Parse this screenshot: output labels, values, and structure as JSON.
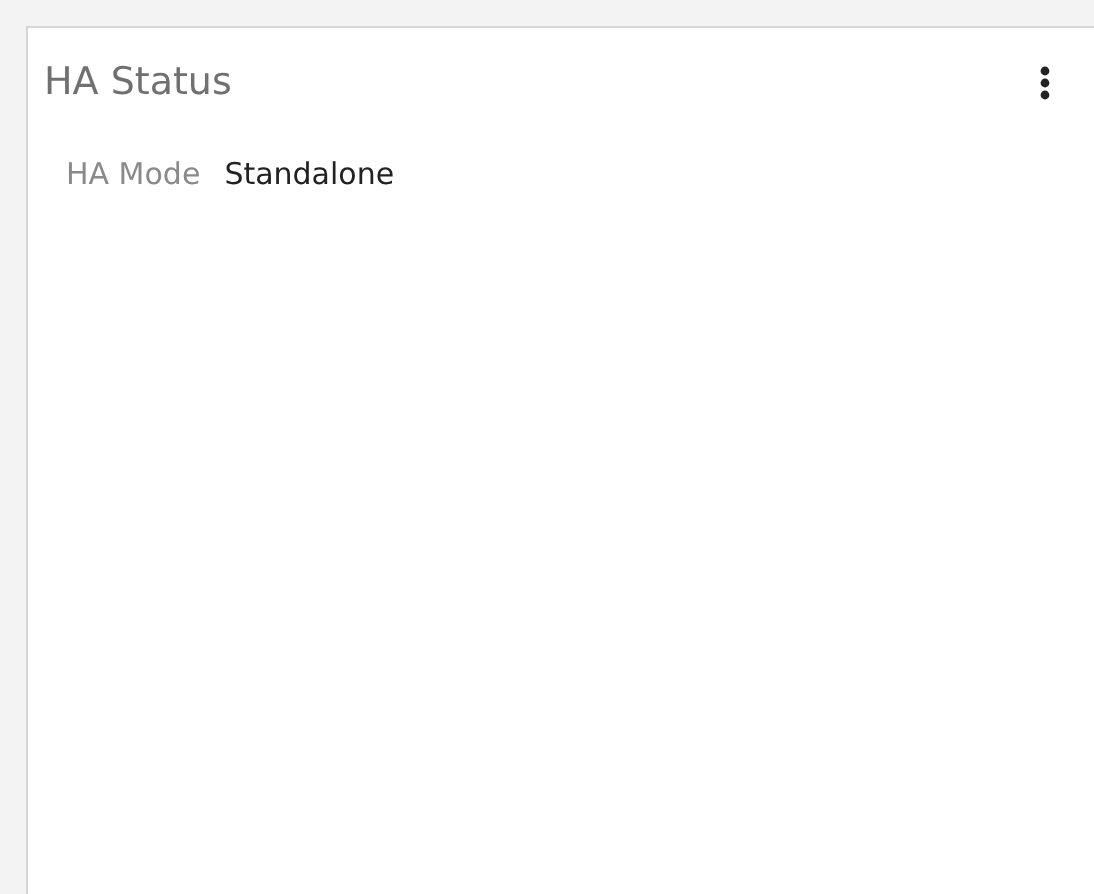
{
  "card": {
    "title": "HA Status",
    "fields": [
      {
        "label": "HA Mode",
        "value": "Standalone"
      }
    ]
  }
}
